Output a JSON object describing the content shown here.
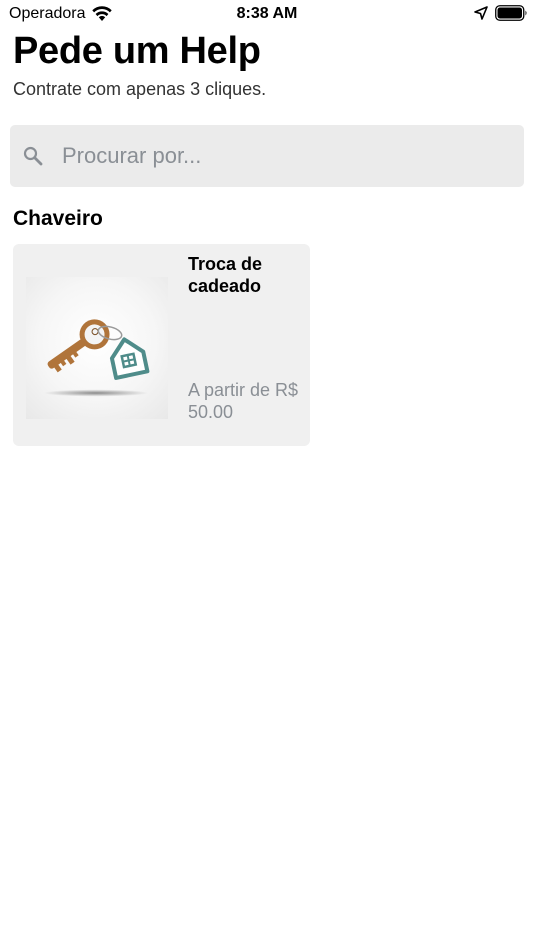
{
  "status_bar": {
    "carrier": "Operadora",
    "time": "8:38 AM",
    "icons": [
      "wifi-icon",
      "location-arrow-icon",
      "battery-icon"
    ]
  },
  "header": {
    "title": "Pede um Help",
    "subtitle": "Contrate com apenas 3 cliques."
  },
  "search": {
    "icon": "search-icon",
    "placeholder": "Procurar por...",
    "value": ""
  },
  "sections": [
    {
      "title": "Chaveiro",
      "services": [
        {
          "title": "Troca de cadeado",
          "price": "A partir de R$ 50.00",
          "image": "key-with-house-keychain"
        }
      ]
    }
  ],
  "colors": {
    "background": "#ffffff",
    "search_background": "#ebebeb",
    "card_background": "#f0f0f0",
    "muted_text": "#8a8f95",
    "key_color": "#b0743a",
    "house_tag_color": "#4f8c8a"
  }
}
